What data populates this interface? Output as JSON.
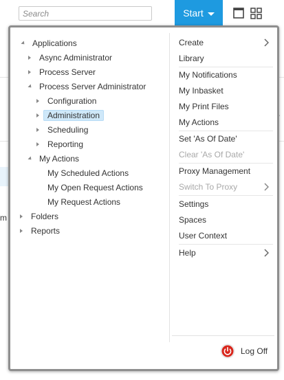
{
  "search": {
    "placeholder": "Search"
  },
  "start_button": {
    "label": "Start"
  },
  "colors": {
    "accent": "#1e9ae0",
    "selected_bg": "#cfe8f9",
    "logoff_red": "#d9261c",
    "disabled_text": "#a8a8a8"
  },
  "tree": [
    {
      "label": "Applications",
      "state": "expanded",
      "level": 0
    },
    {
      "label": "Async Administrator",
      "state": "collapsed",
      "level": 1
    },
    {
      "label": "Process Server",
      "state": "collapsed",
      "level": 1
    },
    {
      "label": "Process Server Administrator",
      "state": "expanded",
      "level": 1
    },
    {
      "label": "Configuration",
      "state": "collapsed",
      "level": 2
    },
    {
      "label": "Administration",
      "state": "collapsed",
      "level": 2,
      "selected": true
    },
    {
      "label": "Scheduling",
      "state": "collapsed",
      "level": 2
    },
    {
      "label": "Reporting",
      "state": "collapsed",
      "level": 2
    },
    {
      "label": "My Actions",
      "state": "expanded",
      "level": 1
    },
    {
      "label": "My Scheduled Actions",
      "state": "leaf",
      "level": 2
    },
    {
      "label": "My Open Request Actions",
      "state": "leaf",
      "level": 2
    },
    {
      "label": "My Request Actions",
      "state": "leaf",
      "level": 2
    },
    {
      "label": "Folders",
      "state": "collapsed",
      "level": 0
    },
    {
      "label": "Reports",
      "state": "collapsed",
      "level": 0
    }
  ],
  "menu": [
    {
      "label": "Create",
      "submenu": true
    },
    {
      "label": "Library"
    },
    {
      "label": "My Notifications"
    },
    {
      "label": "My Inbasket"
    },
    {
      "label": "My Print Files"
    },
    {
      "label": "My Actions"
    },
    {
      "label": "Set 'As Of Date'"
    },
    {
      "label": "Clear 'As Of Date'",
      "disabled": true
    },
    {
      "label": "Proxy Management"
    },
    {
      "label": "Switch To Proxy",
      "disabled": true,
      "submenu": true
    },
    {
      "label": "Settings"
    },
    {
      "label": "Spaces"
    },
    {
      "label": "User Context"
    },
    {
      "label": "Help",
      "submenu": true
    }
  ],
  "logoff": {
    "label": "Log Off"
  },
  "background": {
    "partial_text": "m"
  }
}
